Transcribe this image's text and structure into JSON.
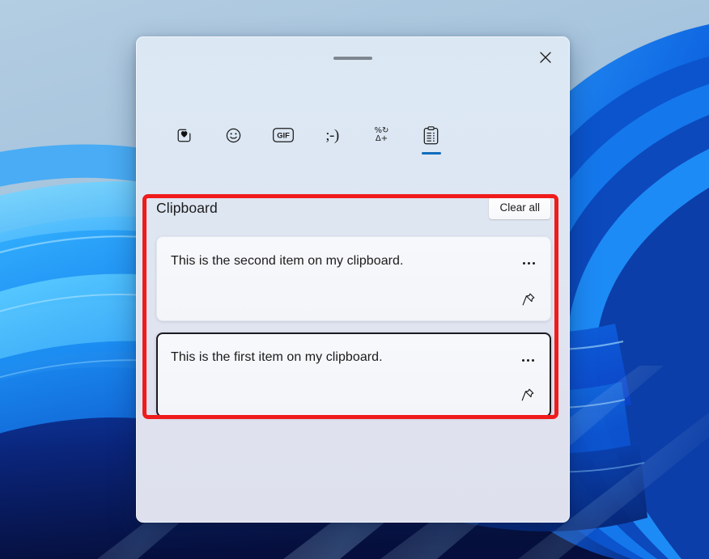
{
  "wallpaper": {
    "name": "windows-11-bloom-wallpaper",
    "sky_color": "#a8c4de",
    "blue_mid": "#1b8ef5",
    "blue_deep": "#0a2f9c",
    "navy": "#0a1d5e"
  },
  "panel": {
    "name": "clipboard-history-flyout",
    "drag_handle_label": "",
    "close_label": "Close",
    "close_icon": "close-icon",
    "accent_color": "#0f6cbd"
  },
  "tabs": [
    {
      "label": "Recently used",
      "icon": "heart-square-icon",
      "active": false
    },
    {
      "label": "Emoji",
      "icon": "smiley-face-icon",
      "active": false
    },
    {
      "label": "GIF",
      "icon": "gif-icon",
      "active": false,
      "text": "GIF"
    },
    {
      "label": "Kaomoji",
      "icon": "kaomoji-icon",
      "active": false,
      "text": ";-)"
    },
    {
      "label": "Symbols",
      "icon": "symbols-icon",
      "active": false,
      "top_text": "%↻",
      "bottom_text": "Δ+"
    },
    {
      "label": "Clipboard history",
      "icon": "clipboard-icon",
      "active": true
    }
  ],
  "header": {
    "title": "Clipboard",
    "clear_all_label": "Clear all"
  },
  "items": [
    {
      "text": "This is the second item on my clipboard.",
      "menu_label": "See more",
      "menu_icon": "ellipsis-icon",
      "pin_label": "Pin",
      "pin_icon": "pin-icon",
      "focused": false
    },
    {
      "text": "This is the first item on my clipboard.",
      "menu_label": "See more",
      "menu_icon": "ellipsis-icon",
      "pin_label": "Pin",
      "pin_icon": "pin-icon",
      "focused": true
    }
  ],
  "annotation": {
    "name": "red-highlight-rectangle",
    "color": "#f01b1b"
  }
}
